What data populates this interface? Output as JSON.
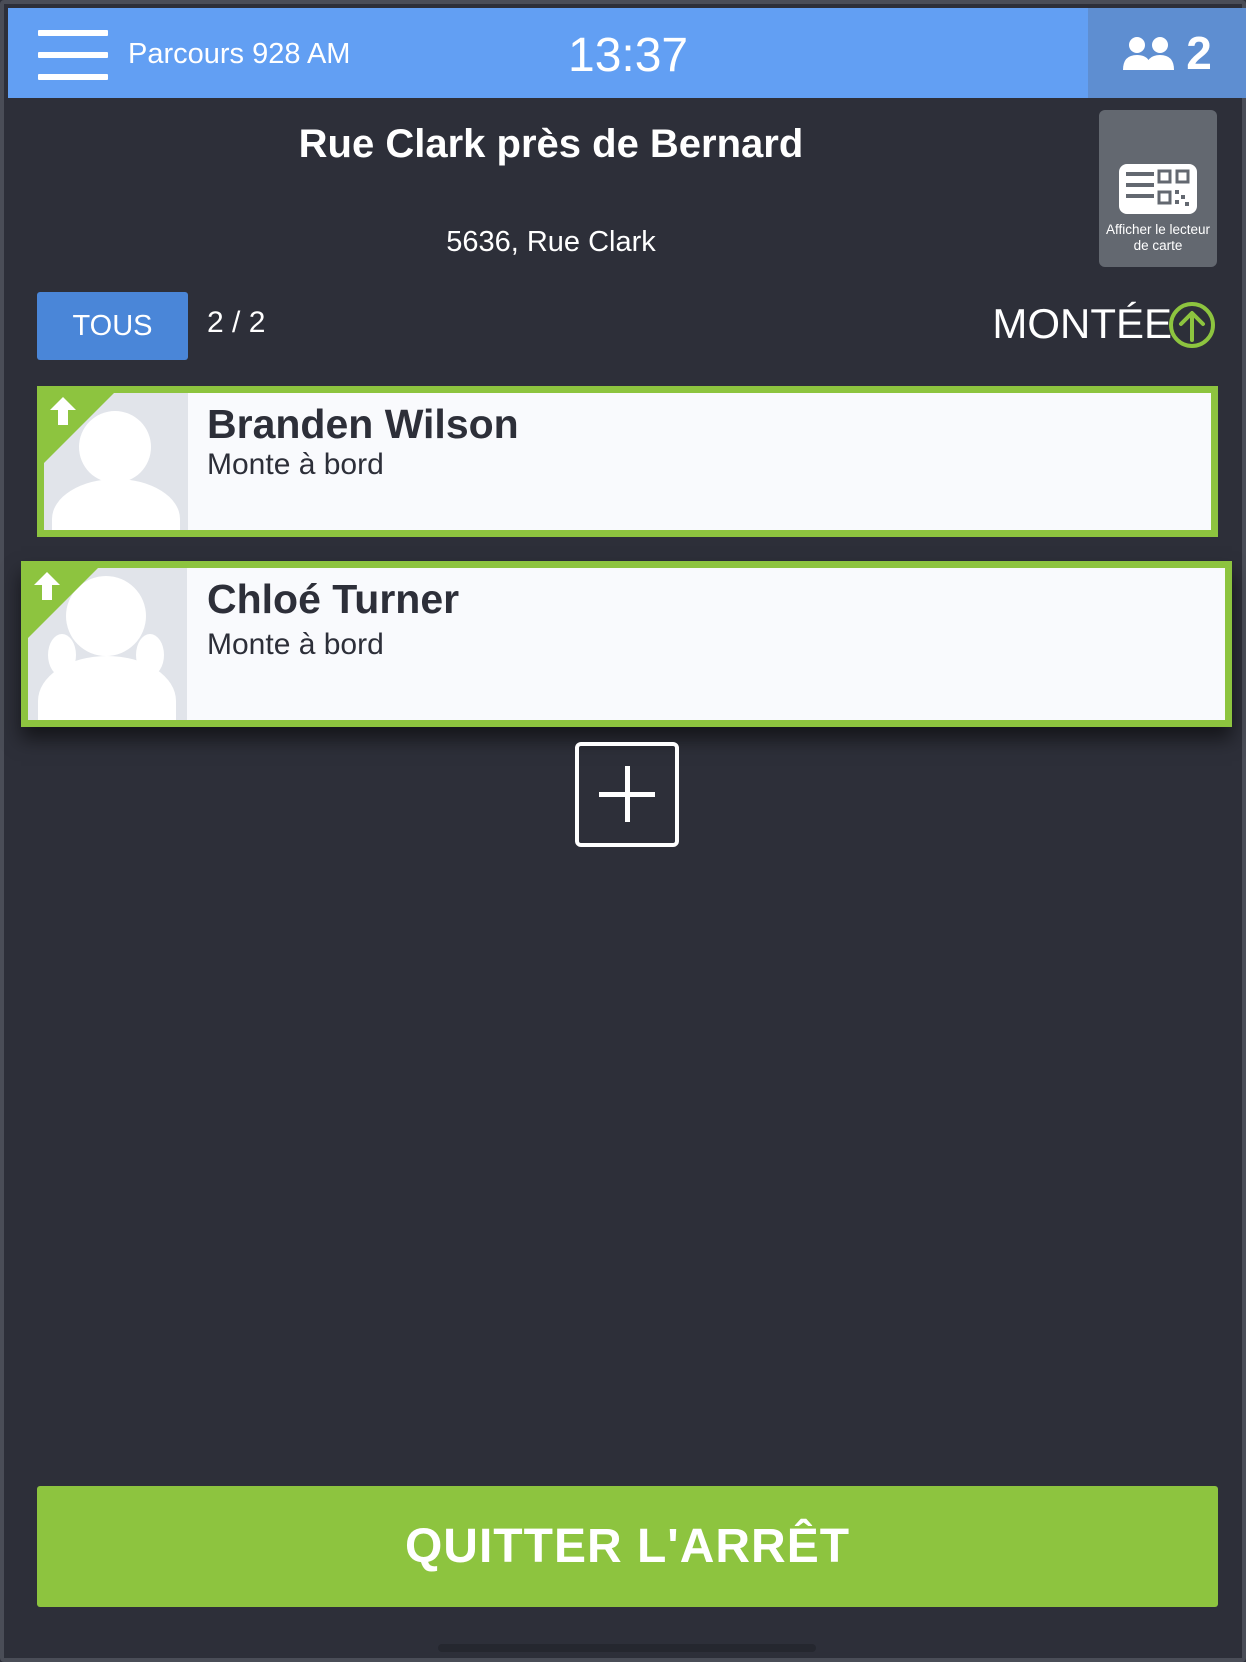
{
  "header": {
    "route_title": "Parcours 928 AM",
    "time": "13:37",
    "rider_count": "2"
  },
  "stop": {
    "name": "Rue Clark près de Bernard",
    "address": "5636, Rue Clark",
    "card_reader_label": "Afficher le lecteur de carte"
  },
  "filter": {
    "all_label": "TOUS",
    "counter": "2 / 2",
    "direction_label": "MONTÉE"
  },
  "riders": [
    {
      "name": "Branden Wilson",
      "status": "Monte à bord"
    },
    {
      "name": "Chloé Turner",
      "status": "Monte à bord"
    }
  ],
  "actions": {
    "exit_label": "QUITTER L'ARRÊT"
  },
  "colors": {
    "header": "#629ff3",
    "background": "#2d2f39",
    "accent_green": "#8dc43f",
    "button_blue": "#4a86d8"
  }
}
